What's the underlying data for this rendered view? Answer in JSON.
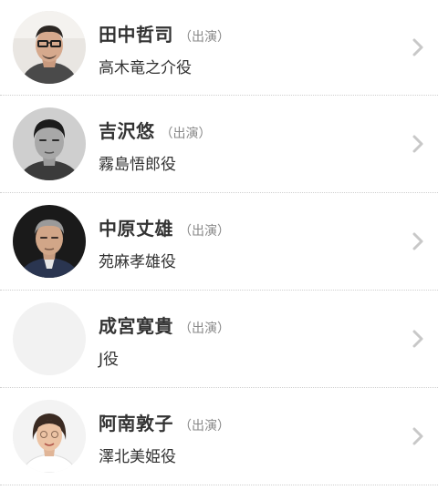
{
  "cast": [
    {
      "name": "田中哲司",
      "appearance": "（出演）",
      "role": "高木竜之介役",
      "avatar_icon": "actor-photo-1"
    },
    {
      "name": "吉沢悠",
      "appearance": "（出演）",
      "role": "霧島悟郎役",
      "avatar_icon": "actor-photo-2"
    },
    {
      "name": "中原丈雄",
      "appearance": "（出演）",
      "role": "苑麻孝雄役",
      "avatar_icon": "actor-photo-3"
    },
    {
      "name": "成宮寛貴",
      "appearance": "（出演）",
      "role": "J役",
      "avatar_icon": "avatar-placeholder"
    },
    {
      "name": "阿南敦子",
      "appearance": "（出演）",
      "role": "澤北美姫役",
      "avatar_icon": "actor-photo-5"
    }
  ],
  "colors": {
    "name_text": "#333333",
    "appearance_text": "#888888",
    "divider": "#cfcfcf",
    "chevron": "#c8c8c8",
    "placeholder_avatar": "#f2f2f2"
  }
}
